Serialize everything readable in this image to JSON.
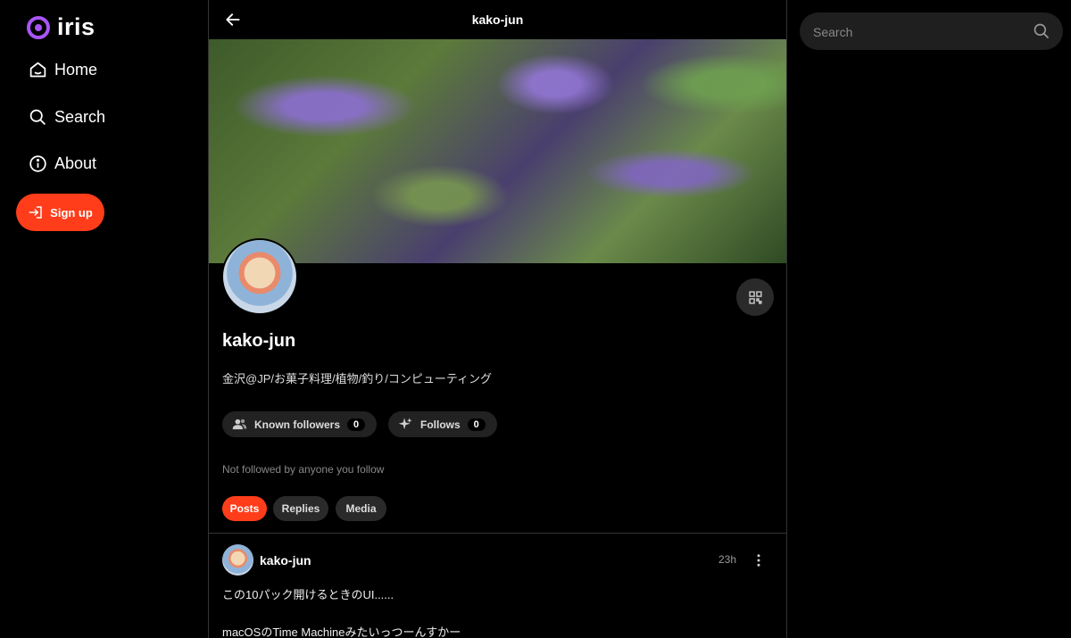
{
  "app": {
    "name": "iris"
  },
  "nav": {
    "home": "Home",
    "search": "Search",
    "about": "About",
    "signup": "Sign up"
  },
  "topbar": {
    "title": "kako-jun"
  },
  "profile": {
    "name": "kako-jun",
    "bio": "金沢@JP/お菓子料理/植物/釣り/コンピューティング",
    "known_followers_label": "Known followers",
    "known_followers_count": "0",
    "follows_label": "Follows",
    "follows_count": "0",
    "follow_note": "Not followed by anyone you follow"
  },
  "tabs": [
    "Posts",
    "Replies",
    "Media"
  ],
  "post": {
    "author": "kako-jun",
    "time": "23h",
    "lines": [
      "この10パック開けるときのUI......",
      "macOSのTime Machineみたいっつーんすかー"
    ]
  },
  "search": {
    "placeholder": "Search"
  },
  "colors": {
    "accent": "#ff3d1a",
    "logo": "#a855f7"
  },
  "icons": [
    "logo-icon",
    "home-icon",
    "search-icon",
    "info-icon",
    "sign-in-icon",
    "back-arrow-icon",
    "qr-code-icon",
    "users-icon",
    "sparkle-icon",
    "more-vertical-icon"
  ]
}
